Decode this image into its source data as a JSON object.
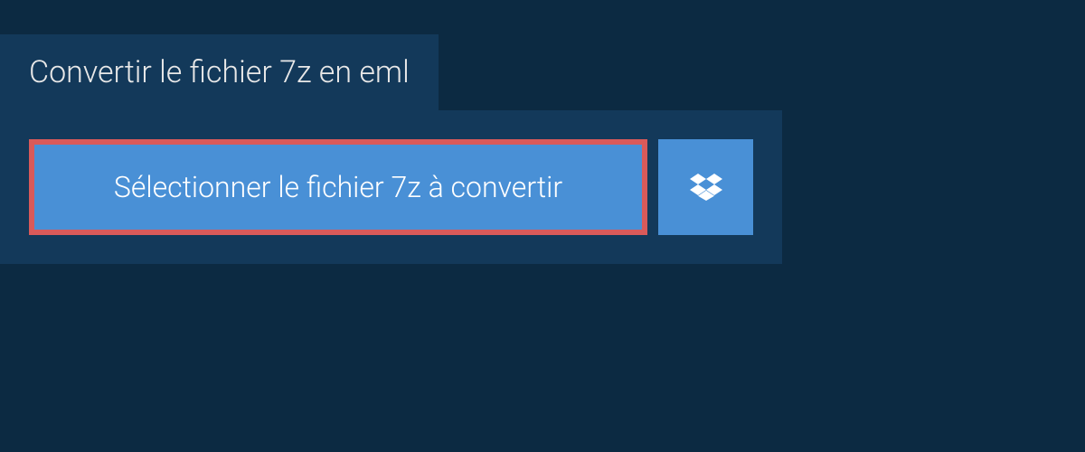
{
  "header": {
    "title": "Convertir le fichier 7z en eml"
  },
  "actions": {
    "select_file_label": "Sélectionner le fichier 7z à convertir"
  },
  "colors": {
    "background": "#0c2a42",
    "panel": "#13395a",
    "button": "#4990d6",
    "highlight_border": "#d95a5a",
    "text_light": "#ffffff"
  }
}
